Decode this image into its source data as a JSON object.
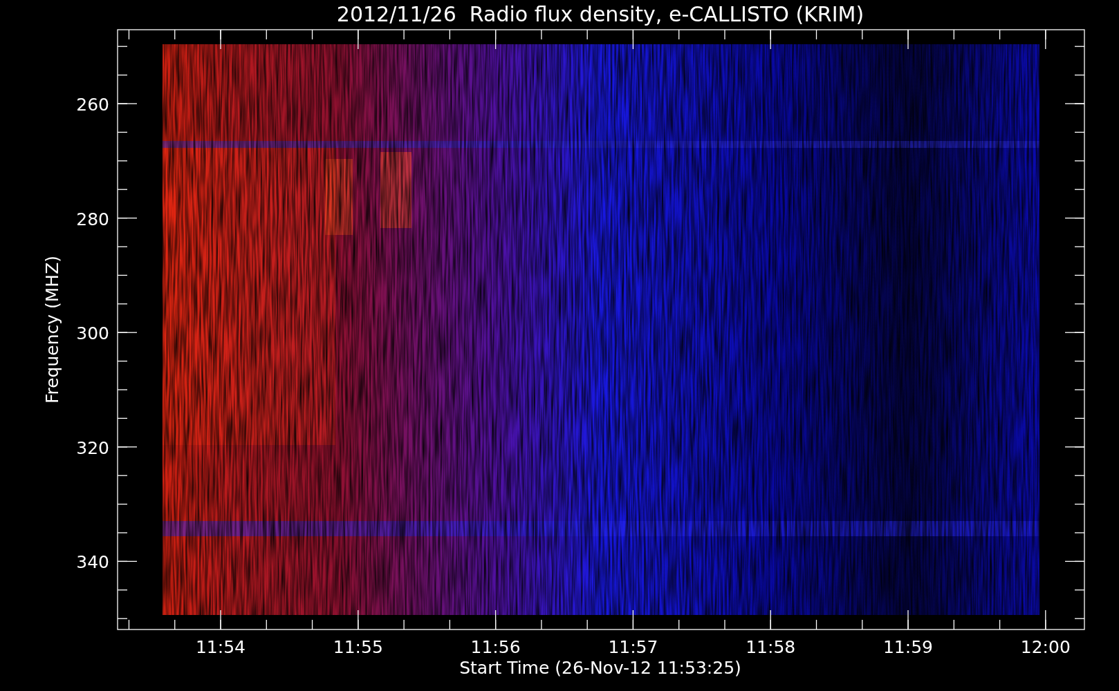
{
  "plot": {
    "title": "2012/11/26  Radio flux density, e-CALLISTO (KRIM)",
    "xlabel": "Start Time (26-Nov-12 11:53:25)",
    "ylabel": "Frequency (MHZ)",
    "xticks": [
      "11:54",
      "11:55",
      "11:56",
      "11:57",
      "11:58",
      "11:59",
      "12:00"
    ],
    "yticks": [
      "260",
      "280",
      "300",
      "320",
      "340"
    ]
  }
}
